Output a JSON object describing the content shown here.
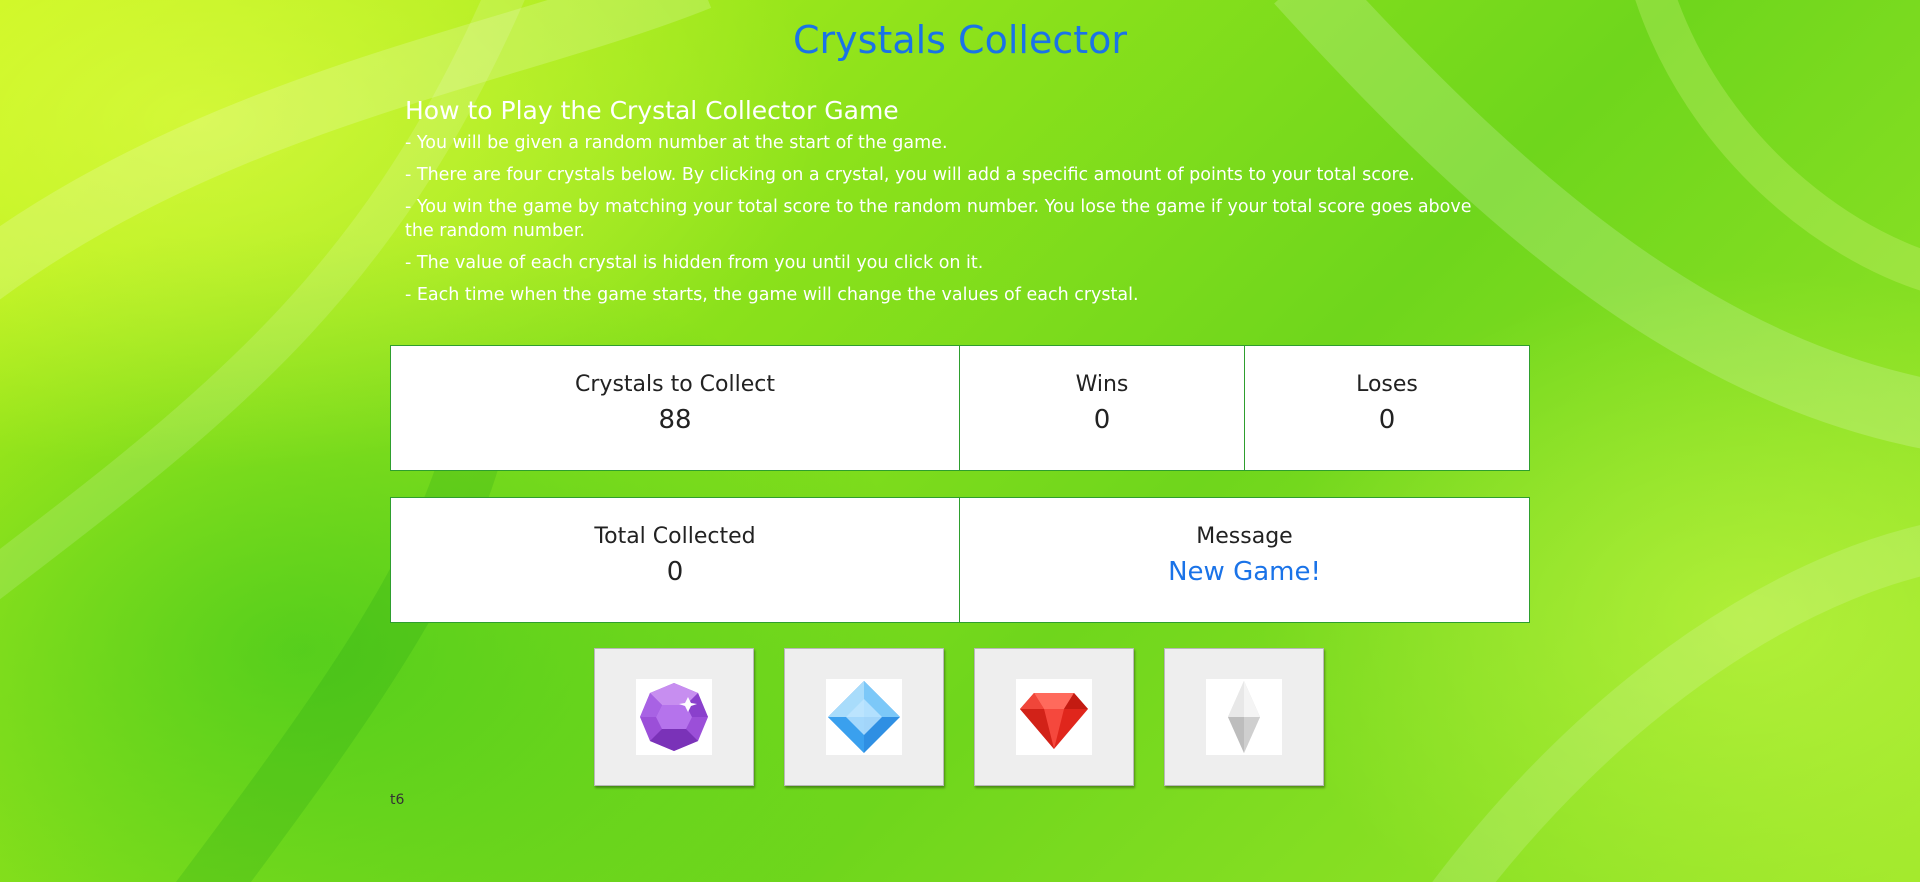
{
  "game": {
    "title": "Crystals Collector",
    "footer_tag": "t6"
  },
  "instructions": {
    "heading": "How to Play the Crystal Collector Game",
    "lines": [
      "- You will be given a random number at the start of the game.",
      "- There are four crystals below. By clicking on a crystal, you will add a specific amount of points to your total score.",
      "- You win the game by matching your total score to the random number. You lose the game if your total score goes above the random number.",
      "- The value of each crystal is hidden from you until you click on it.",
      "- Each time when the game starts, the game will change the values of each crystal."
    ]
  },
  "scoreboard": {
    "target": {
      "label": "Crystals to Collect",
      "value": "88"
    },
    "wins": {
      "label": "Wins",
      "value": "0"
    },
    "loses": {
      "label": "Loses",
      "value": "0"
    },
    "total": {
      "label": "Total Collected",
      "value": "0"
    },
    "message": {
      "label": "Message",
      "value": "New Game!"
    }
  },
  "crystals": [
    {
      "icon": "purple-gem-icon",
      "color": "#a65be0"
    },
    {
      "icon": "blue-gem-icon",
      "color": "#3ea3ef"
    },
    {
      "icon": "red-gem-icon",
      "color": "#e8342a"
    },
    {
      "icon": "white-gem-icon",
      "color": "#d8d8d8"
    }
  ],
  "colors": {
    "title": "#1a73e8",
    "message": "#1a73e8",
    "panel_border": "#2e9e2e"
  }
}
